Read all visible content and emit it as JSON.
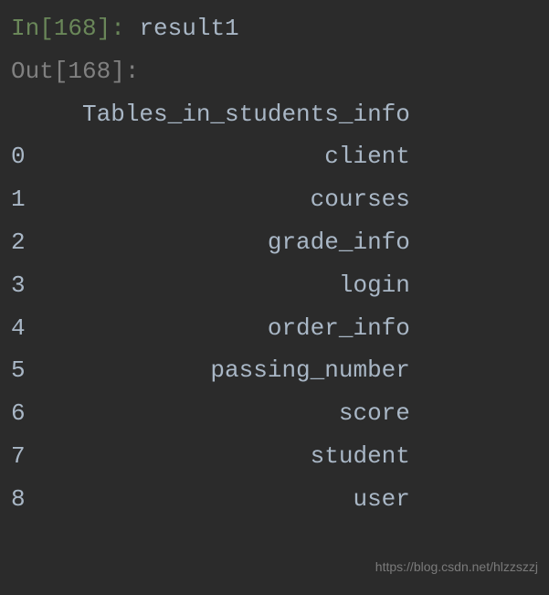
{
  "input": {
    "prompt_prefix": "In[",
    "execution_count": "168",
    "prompt_suffix": "]: ",
    "code": "result1"
  },
  "output": {
    "prompt_prefix": "Out[",
    "execution_count": "168",
    "prompt_suffix": "]:"
  },
  "chart_data": {
    "type": "table",
    "title": "",
    "columns": [
      "Tables_in_students_info"
    ],
    "index": [
      "0",
      "1",
      "2",
      "3",
      "4",
      "5",
      "6",
      "7",
      "8"
    ],
    "rows": [
      [
        "client"
      ],
      [
        "courses"
      ],
      [
        "grade_info"
      ],
      [
        "login"
      ],
      [
        "order_info"
      ],
      [
        "passing_number"
      ],
      [
        "score"
      ],
      [
        "student"
      ],
      [
        "user"
      ]
    ]
  },
  "watermark": "https://blog.csdn.net/hlzzszzj"
}
